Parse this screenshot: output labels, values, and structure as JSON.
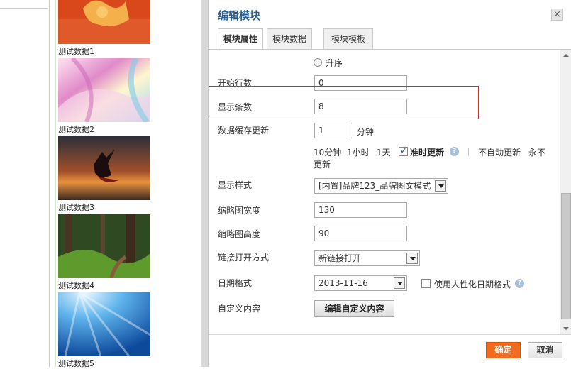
{
  "left_panel": {
    "thumbnails": [
      {
        "caption": "测试数据1"
      },
      {
        "caption": "测试数据2"
      },
      {
        "caption": "测试数据3"
      },
      {
        "caption": "测试数据4"
      },
      {
        "caption": "测试数据5"
      }
    ]
  },
  "dialog": {
    "title": "编辑模块",
    "close_icon": "×",
    "tabs": [
      {
        "label": "模块属性",
        "active": true
      },
      {
        "label": "模块数据",
        "active": false
      },
      {
        "label": "模块模板",
        "active": false
      }
    ],
    "form": {
      "sort_option_label": "升序",
      "start_row": {
        "label": "开始行数",
        "value": "0"
      },
      "display_count": {
        "label": "显示条数",
        "value": "8"
      },
      "cache": {
        "label": "数据缓存更新",
        "value": "1",
        "unit": "分钟",
        "presets": [
          "10分钟",
          "1小时",
          "1天"
        ],
        "timely_update_label": "准时更新",
        "timely_update_checked": true,
        "no_auto_update": "不自动更新",
        "never_update_line1": "永不",
        "never_update_line2": "更新"
      },
      "display_style": {
        "label": "显示样式",
        "value": "[内置]品牌123_品牌图文模式"
      },
      "thumb_width": {
        "label": "缩略图宽度",
        "value": "130"
      },
      "thumb_height": {
        "label": "缩略图高度",
        "value": "90"
      },
      "link_open": {
        "label": "链接打开方式",
        "value": "新链接打开"
      },
      "date_format": {
        "label": "日期格式",
        "value": "2013-11-16",
        "humanize_label": "使用人性化日期格式",
        "humanize_checked": false
      },
      "custom_content": {
        "label": "自定义内容",
        "button_label": "编辑自定义内容"
      }
    },
    "footer": {
      "ok_label": "确定",
      "cancel_label": "取消"
    }
  },
  "colors": {
    "accent": "#f16b1e",
    "title": "#2d5f8e",
    "highlight_box": "#c9302c"
  }
}
